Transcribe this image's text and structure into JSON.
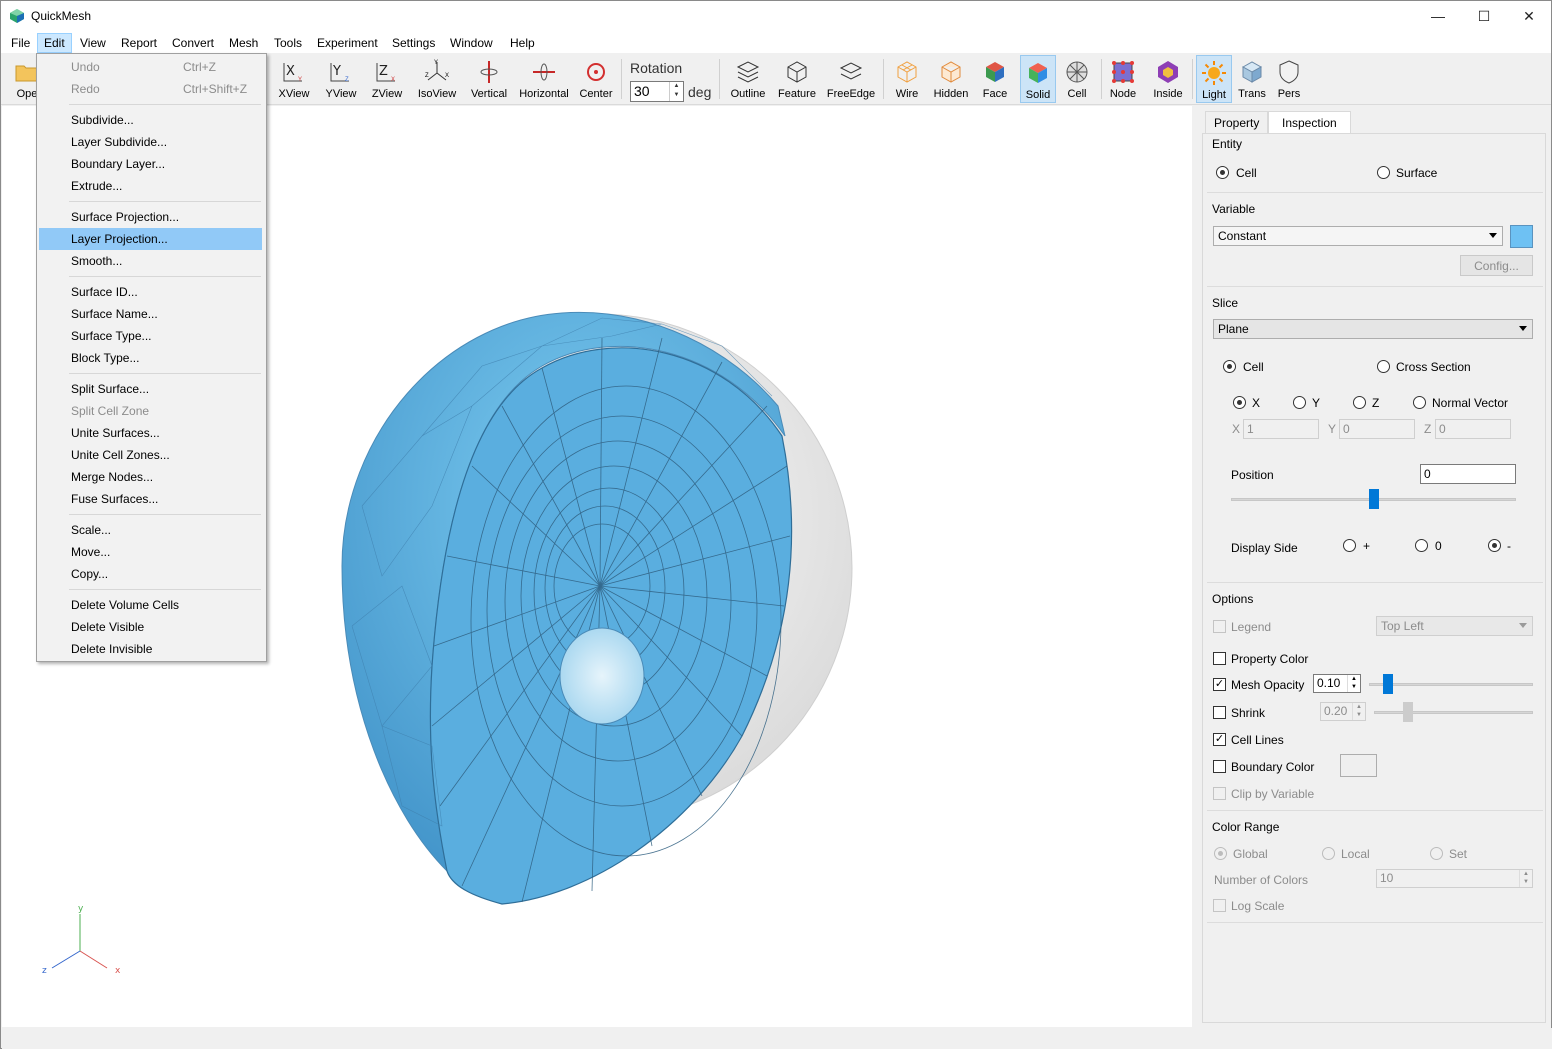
{
  "app": {
    "title": "QuickMesh"
  },
  "window_controls": {
    "minimize": "—",
    "maximize": "☐",
    "close": "✕"
  },
  "menubar": [
    "File",
    "Edit",
    "View",
    "Report",
    "Convert",
    "Mesh",
    "Tools",
    "Experiment",
    "Settings",
    "Window",
    "Help"
  ],
  "toolbar": {
    "open_label": "Ope",
    "buttons": [
      "XView",
      "YView",
      "ZView",
      "IsoView",
      "Vertical",
      "Horizontal",
      "Center"
    ],
    "rotation_label": "Rotation",
    "rotation_value": "30",
    "rotation_unit": "deg",
    "display_buttons": [
      "Outline",
      "Feature",
      "FreeEdge",
      "Wire",
      "Hidden",
      "Face",
      "Solid",
      "Cell",
      "Node",
      "Inside",
      "Light",
      "Trans",
      "Pers"
    ],
    "pressed": [
      "Solid",
      "Light"
    ]
  },
  "edit_menu": {
    "items": [
      {
        "label": "Undo",
        "shortcut": "Ctrl+Z",
        "disabled": true
      },
      {
        "label": "Redo",
        "shortcut": "Ctrl+Shift+Z",
        "disabled": true
      },
      {
        "label": "Subdivide..."
      },
      {
        "label": "Layer Subdivide..."
      },
      {
        "label": "Boundary Layer..."
      },
      {
        "label": "Extrude..."
      },
      {
        "label": "Surface Projection..."
      },
      {
        "label": "Layer Projection...",
        "highlighted": true
      },
      {
        "label": "Smooth..."
      },
      {
        "label": "Surface ID..."
      },
      {
        "label": "Surface Name..."
      },
      {
        "label": "Surface Type..."
      },
      {
        "label": "Block Type..."
      },
      {
        "label": "Split Surface..."
      },
      {
        "label": "Split Cell Zone",
        "disabled": true
      },
      {
        "label": "Unite Surfaces..."
      },
      {
        "label": "Unite Cell Zones..."
      },
      {
        "label": "Merge Nodes..."
      },
      {
        "label": "Fuse Surfaces..."
      },
      {
        "label": "Scale..."
      },
      {
        "label": "Move..."
      },
      {
        "label": "Copy..."
      },
      {
        "label": "Delete Volume Cells"
      },
      {
        "label": "Delete Visible"
      },
      {
        "label": "Delete Invisible"
      }
    ]
  },
  "panel": {
    "tabs": [
      "Property",
      "Inspection"
    ],
    "active_tab": "Inspection",
    "entity": {
      "title": "Entity",
      "options": [
        "Cell",
        "Surface"
      ],
      "selected": "Cell"
    },
    "variable": {
      "title": "Variable",
      "value": "Constant",
      "config_button": "Config...",
      "swatch_color": "#6ec1f3"
    },
    "slice": {
      "title": "Slice",
      "mode": "Plane",
      "types": [
        "Cell",
        "Cross Section"
      ],
      "type_selected": "Cell",
      "axes": [
        "X",
        "Y",
        "Z",
        "Normal Vector"
      ],
      "axis_selected": "X",
      "vec_labels": [
        "X",
        "Y",
        "Z"
      ],
      "vec_values": [
        "1",
        "0",
        "0"
      ],
      "position_label": "Position",
      "position_value": "0",
      "position_slider_fraction": 0.5,
      "display_side_label": "Display Side",
      "display_sides": [
        "+",
        "0",
        "-"
      ],
      "display_side_selected": "-"
    },
    "options": {
      "title": "Options",
      "legend_label": "Legend",
      "legend_position": "Top Left",
      "property_color_label": "Property Color",
      "mesh_opacity_label": "Mesh Opacity",
      "mesh_opacity_value": "0.10",
      "mesh_opacity_fraction": 0.1,
      "shrink_label": "Shrink",
      "shrink_value": "0.20",
      "shrink_fraction": 0.2,
      "cell_lines_label": "Cell Lines",
      "boundary_color_label": "Boundary Color",
      "clip_by_variable_label": "Clip by Variable"
    },
    "color_range": {
      "title": "Color Range",
      "modes": [
        "Global",
        "Local",
        "Set"
      ],
      "mode_selected": "Global",
      "num_colors_label": "Number of Colors",
      "num_colors_value": "10",
      "log_scale_label": "Log Scale"
    }
  },
  "axes": {
    "x": "x",
    "y": "y",
    "z": "z",
    "x_color": "#d9534f",
    "y_color": "#4caf50",
    "z_color": "#3366cc"
  },
  "colors": {
    "mesh_blue": "#5aaedf",
    "highlight": "#91c9f7",
    "accent": "#0078d7"
  }
}
